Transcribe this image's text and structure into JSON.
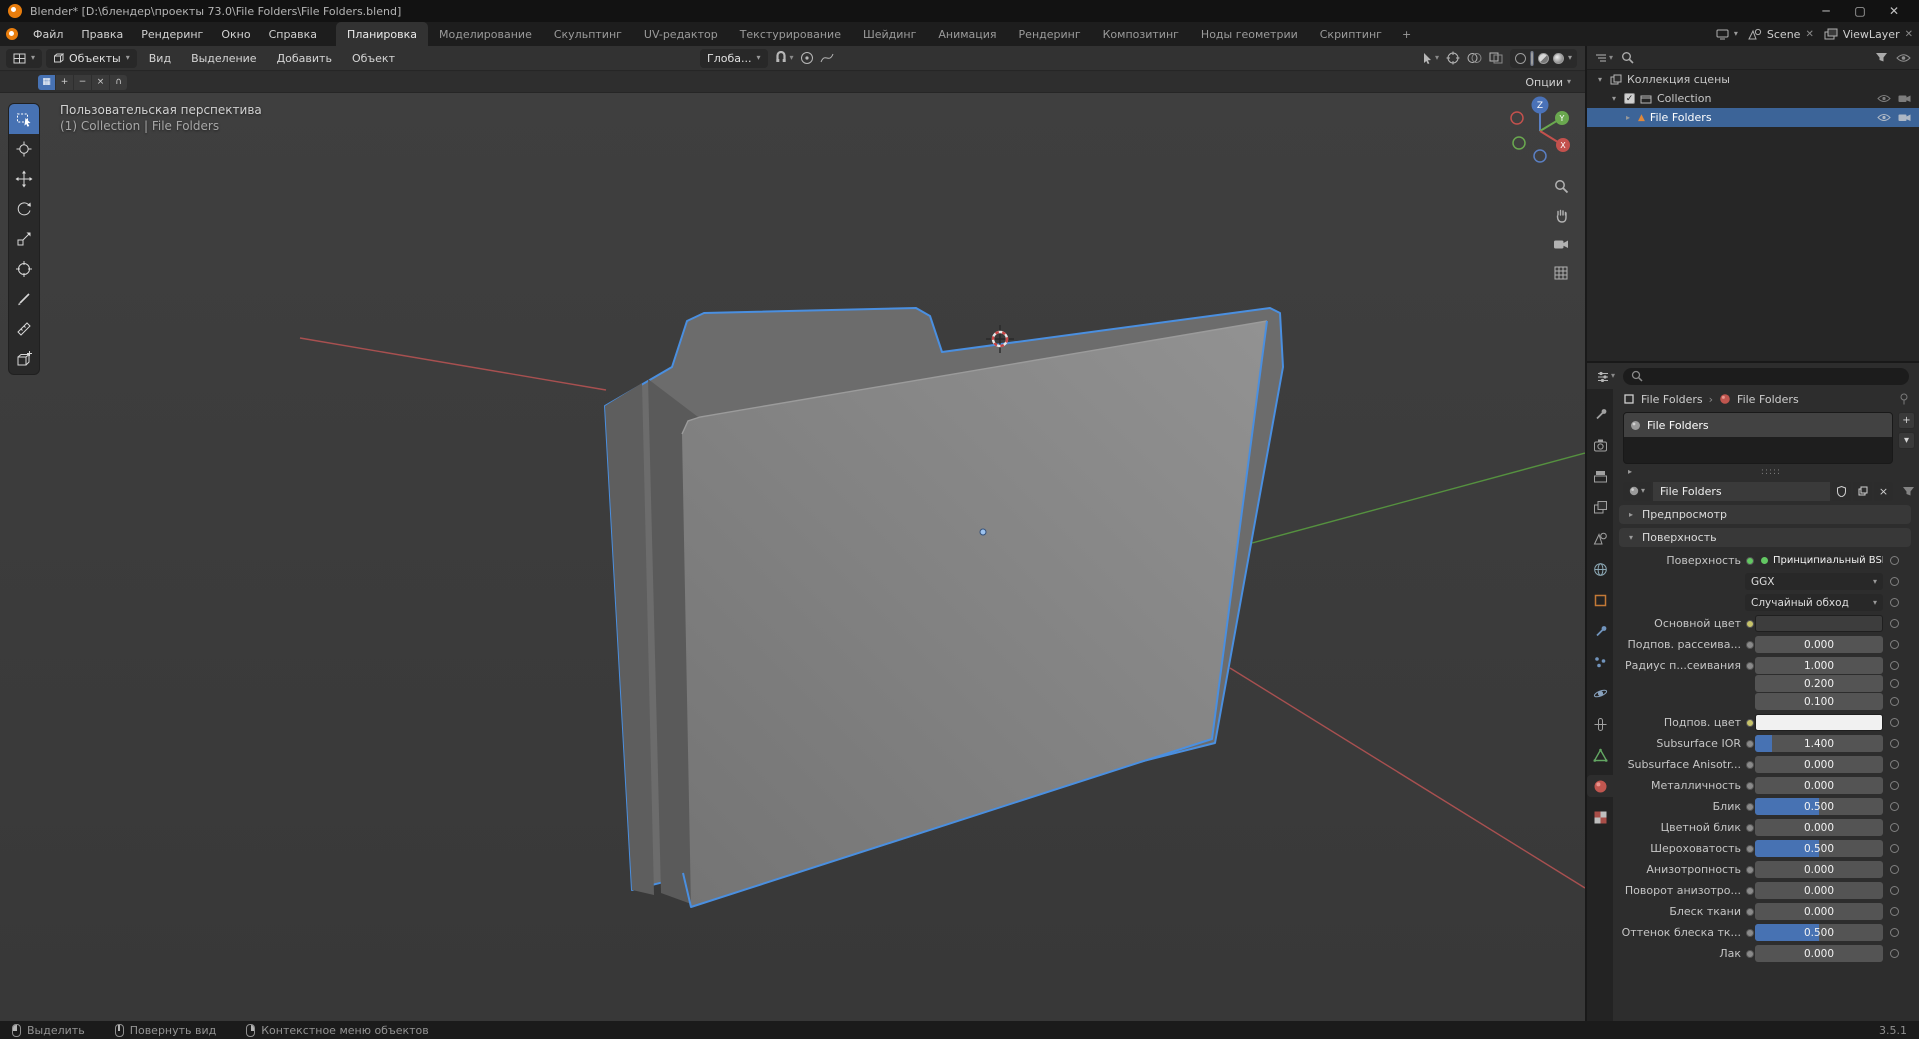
{
  "window": {
    "title": "Blender* [D:\\блендер\\проекты 73.0\\File Folders\\File Folders.blend]"
  },
  "topbar": {
    "menus": [
      "Файл",
      "Правка",
      "Рендеринг",
      "Окно",
      "Справка"
    ],
    "workspaces": [
      "Планировка",
      "Моделирование",
      "Скульптинг",
      "UV-редактор",
      "Текстурирование",
      "Шейдинг",
      "Анимация",
      "Рендеринг",
      "Композитинг",
      "Ноды геометрии",
      "Скриптинг"
    ],
    "active_workspace": "Планировка",
    "add_tab": "+",
    "scene_label": "Scene",
    "viewlayer_label": "ViewLayer"
  },
  "viewport": {
    "header": {
      "mode": "Объекты",
      "menus": [
        "Вид",
        "Выделение",
        "Добавить",
        "Объект"
      ],
      "orientation": "Глоба...",
      "options_label": "Опции"
    },
    "overlay": {
      "view_label": "Пользовательская перспектива",
      "context_label": "(1) Collection | File Folders"
    },
    "gizmo_axes": [
      "Z",
      "Y",
      "X"
    ]
  },
  "outliner": {
    "scene_collection": "Коллекция сцены",
    "collection": "Collection",
    "object": "File Folders"
  },
  "properties": {
    "breadcrumb": {
      "object": "File Folders",
      "separator": "›",
      "data": "File Folders"
    },
    "slot_name": "File Folders",
    "id_name": "File Folders",
    "panels": {
      "preview": "Предпросмотр",
      "surface": "Поверхность"
    },
    "rows": [
      {
        "label": "Поверхность",
        "value": "Принципиальный BSDF",
        "type": "shader"
      },
      {
        "label": "",
        "value": "GGX",
        "type": "dropdown"
      },
      {
        "label": "",
        "value": "Случайный обход",
        "type": "dropdown"
      },
      {
        "label": "Основной цвет",
        "type": "color",
        "color": "#3d3d3d"
      },
      {
        "label": "Подпов. рассеива...",
        "value": "0.000",
        "type": "slider",
        "fill": 0
      },
      {
        "label": "Радиус п...сеивания",
        "value": "1.000",
        "type": "field"
      },
      {
        "label": "",
        "value": "0.200",
        "type": "field"
      },
      {
        "label": "",
        "value": "0.100",
        "type": "field"
      },
      {
        "label": "Подпов. цвет",
        "type": "color",
        "color": "#f1f1f1"
      },
      {
        "label": "Subsurface IOR",
        "value": "1.400",
        "type": "slider",
        "fill": 0.13
      },
      {
        "label": "Subsurface Anisotr...",
        "value": "0.000",
        "type": "slider",
        "fill": 0
      },
      {
        "label": "Металличность",
        "value": "0.000",
        "type": "slider",
        "fill": 0
      },
      {
        "label": "Блик",
        "value": "0.500",
        "type": "slider",
        "fill": 0.5
      },
      {
        "label": "Цветной блик",
        "value": "0.000",
        "type": "slider",
        "fill": 0
      },
      {
        "label": "Шероховатость",
        "value": "0.500",
        "type": "slider",
        "fill": 0.5
      },
      {
        "label": "Анизотропность",
        "value": "0.000",
        "type": "slider",
        "fill": 0
      },
      {
        "label": "Поворот анизотро...",
        "value": "0.000",
        "type": "slider",
        "fill": 0
      },
      {
        "label": "Блеск ткани",
        "value": "0.000",
        "type": "slider",
        "fill": 0
      },
      {
        "label": "Оттенок блеска тк...",
        "value": "0.500",
        "type": "slider",
        "fill": 0.5
      },
      {
        "label": "Лак",
        "value": "0.000",
        "type": "slider",
        "fill": 0
      }
    ]
  },
  "statusbar": {
    "hints": [
      "Выделить",
      "Повернуть вид",
      "Контекстное меню объектов"
    ],
    "version": "3.5.1"
  },
  "colors": {
    "accent": "#4772b3",
    "outline": "#4a8fe0",
    "select-row": "#3c6498",
    "slider-fill": "#4772b3"
  }
}
